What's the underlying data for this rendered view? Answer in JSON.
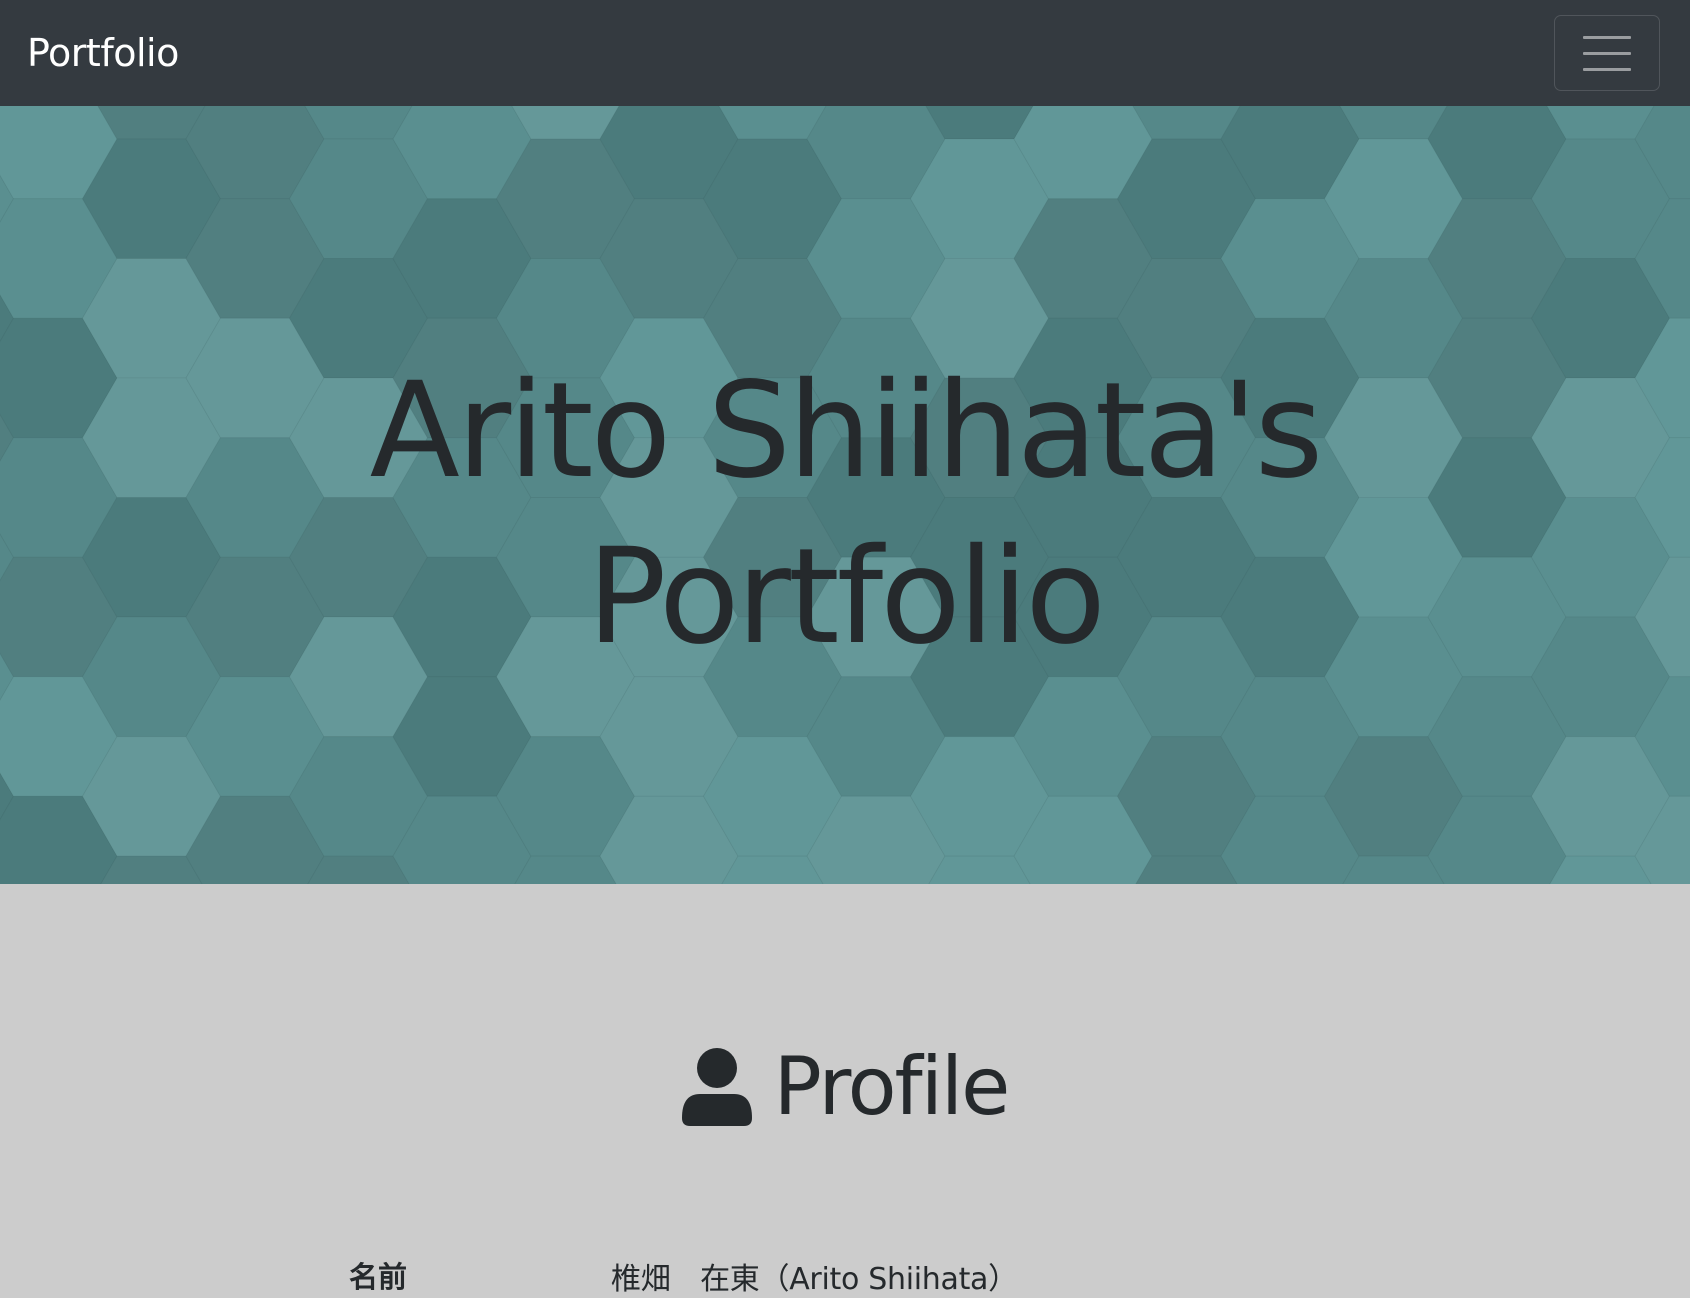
{
  "navbar": {
    "brand": "Portfolio",
    "toggler_icon": "hamburger-menu-icon"
  },
  "hero": {
    "title_line1": "Arito Shiihata's",
    "title_line2": "Portfolio",
    "background_pattern": "hexagon-tiles",
    "colors": [
      "#4b7b7c",
      "#517f80",
      "#558889",
      "#5a8f90",
      "#619798",
      "#659899"
    ]
  },
  "profile": {
    "icon": "user-icon",
    "title": "Profile",
    "rows": [
      {
        "label": "名前",
        "value": "椎畑　在東（Arito Shiihata）"
      }
    ]
  },
  "colors": {
    "navbar_bg": "#343a40",
    "section_bg": "#cccccc",
    "text_dark": "#25292c"
  }
}
